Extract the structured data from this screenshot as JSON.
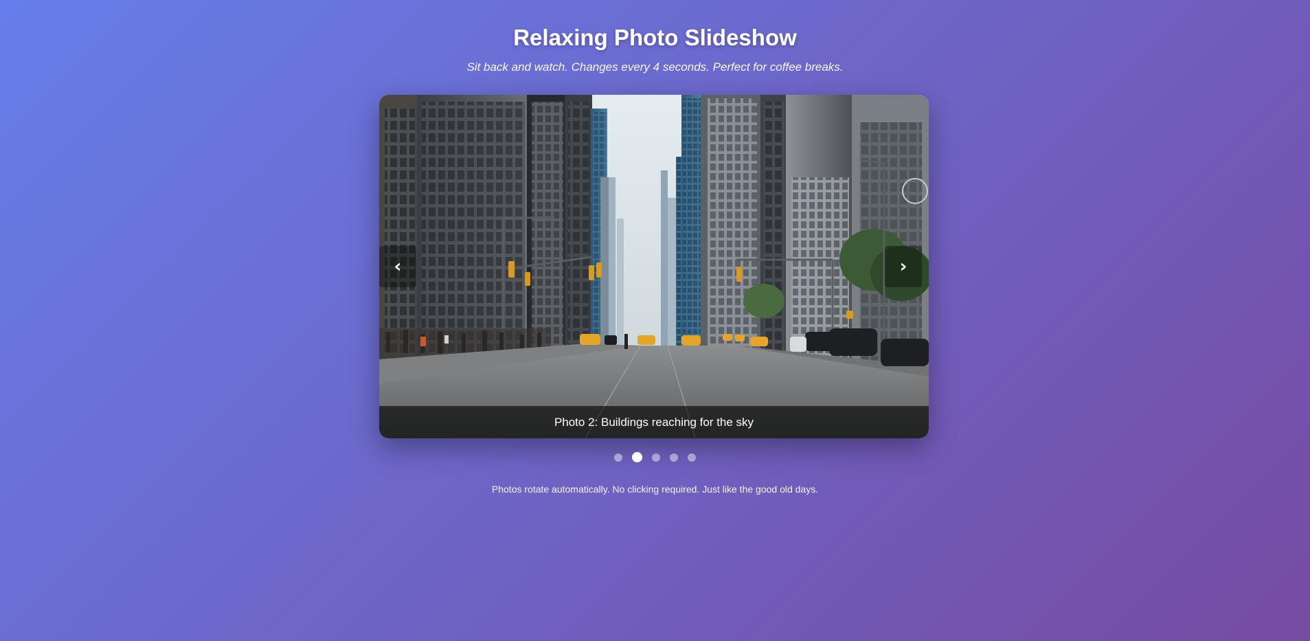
{
  "header": {
    "title": "Relaxing Photo Slideshow",
    "subtitle": "Sit back and watch. Changes every 4 seconds. Perfect for coffee breaks."
  },
  "slideshow": {
    "caption": "Photo 2: Buildings reaching for the sky",
    "prev_label": "‹",
    "next_label": "›",
    "total_slides": 5,
    "active_slide": 2,
    "photo_subject": "city street lined with skyscrapers and yellow taxis"
  },
  "footer": {
    "note": "Photos rotate automatically. No clicking required. Just like the good old days."
  },
  "colors": {
    "background_start": "#667eea",
    "background_end": "#764ba2",
    "taxi_yellow": "#e3a52a"
  }
}
